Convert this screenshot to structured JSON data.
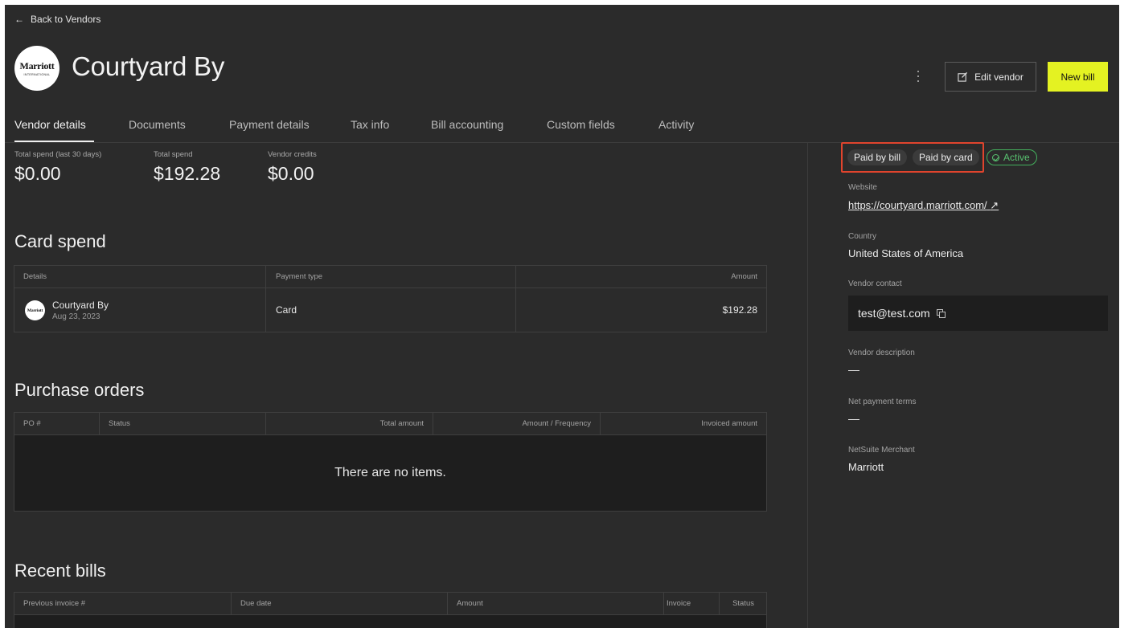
{
  "header": {
    "back_label": "Back to Vendors",
    "vendor_name": "Courtyard By",
    "logo_text": "Marriott",
    "logo_subtext": "INTERNATIONAL",
    "edit_label": "Edit vendor",
    "new_bill_label": "New bill"
  },
  "tabs": [
    {
      "label": "Vendor details",
      "active": true
    },
    {
      "label": "Documents"
    },
    {
      "label": "Payment details"
    },
    {
      "label": "Tax info"
    },
    {
      "label": "Bill accounting"
    },
    {
      "label": "Custom fields"
    },
    {
      "label": "Activity"
    }
  ],
  "stats": [
    {
      "label": "Total spend (last 30 days)",
      "value": "$0.00"
    },
    {
      "label": "Total spend",
      "value": "$192.28"
    },
    {
      "label": "Vendor credits",
      "value": "$0.00"
    }
  ],
  "card_spend": {
    "title": "Card spend",
    "columns": [
      "Details",
      "Payment type",
      "Amount"
    ],
    "rows": [
      {
        "name": "Courtyard By",
        "date": "Aug 23, 2023",
        "payment_type": "Card",
        "amount": "$192.28",
        "logo_text": "Marriott"
      }
    ]
  },
  "purchase_orders": {
    "title": "Purchase orders",
    "columns": [
      "PO #",
      "Status",
      "Total amount",
      "Amount / Frequency",
      "Invoiced amount"
    ],
    "empty_text": "There are no items."
  },
  "recent_bills": {
    "title": "Recent bills",
    "columns": [
      "Previous invoice #",
      "Due date",
      "Amount",
      "Invoice",
      "Status"
    ]
  },
  "sidebar": {
    "chips": [
      "Paid by bill",
      "Paid by card"
    ],
    "status": "Active",
    "website_label": "Website",
    "website": "https://courtyard.marriott.com/",
    "country_label": "Country",
    "country": "United States of America",
    "contact_label": "Vendor contact",
    "contact": "test@test.com",
    "description_label": "Vendor description",
    "description": "—",
    "terms_label": "Net payment terms",
    "terms": "—",
    "netsuite_label": "NetSuite Merchant",
    "netsuite": "Marriott"
  },
  "colors": {
    "background": "#2b2b2b",
    "accent": "#e4f222",
    "active_status": "#58c270",
    "highlight": "#e0442d"
  }
}
